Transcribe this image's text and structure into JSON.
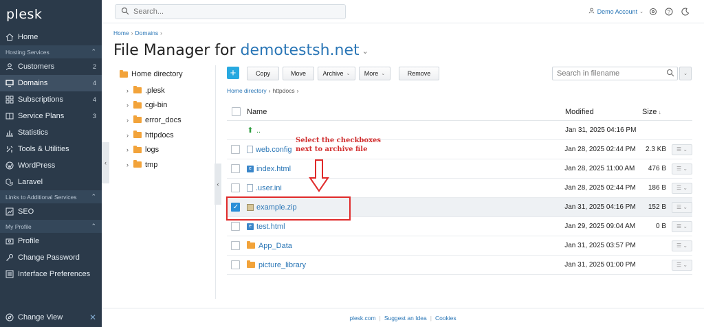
{
  "sidebar": {
    "logo": "plesk",
    "home": "Home",
    "hosting_section": "Hosting Services",
    "items": [
      {
        "label": "Customers",
        "count": "2",
        "icon": "user-icon"
      },
      {
        "label": "Domains",
        "count": "4",
        "icon": "monitor-icon"
      },
      {
        "label": "Subscriptions",
        "count": "4",
        "icon": "grid-icon"
      },
      {
        "label": "Service Plans",
        "count": "3",
        "icon": "book-icon"
      },
      {
        "label": "Statistics",
        "count": "",
        "icon": "chart-icon"
      },
      {
        "label": "Tools & Utilities",
        "count": "",
        "icon": "tools-icon"
      },
      {
        "label": "WordPress",
        "count": "",
        "icon": "wordpress-icon"
      },
      {
        "label": "Laravel",
        "count": "",
        "icon": "laravel-icon"
      }
    ],
    "links_section": "Links to Additional Services",
    "seo": "SEO",
    "profile_section": "My Profile",
    "profile": "Profile",
    "change_password": "Change Password",
    "interface_prefs": "Interface Preferences",
    "change_view": "Change View"
  },
  "header": {
    "search_placeholder": "Search...",
    "account": "Demo Account"
  },
  "breadcrumb": {
    "home": "Home",
    "domains": "Domains"
  },
  "title": {
    "prefix": "File Manager for",
    "domain": "demotestsh.net"
  },
  "tree": {
    "root": "Home directory",
    "items": [
      ".plesk",
      "cgi-bin",
      "error_docs",
      "httpdocs",
      "logs",
      "tmp"
    ]
  },
  "toolbar": {
    "copy": "Copy",
    "move": "Move",
    "archive": "Archive",
    "more": "More",
    "remove": "Remove",
    "search_placeholder": "Search in filename"
  },
  "path": {
    "root": "Home directory",
    "current": "httpdocs"
  },
  "table": {
    "col_name": "Name",
    "col_modified": "Modified",
    "col_size": "Size",
    "rows": [
      {
        "name": "..",
        "modified": "Jan 31, 2025 04:16 PM",
        "size": "",
        "type": "up"
      },
      {
        "name": "web.config",
        "modified": "Jan 28, 2025 02:44 PM",
        "size": "2.3 KB",
        "type": "file"
      },
      {
        "name": "index.html",
        "modified": "Jan 28, 2025 11:00 AM",
        "size": "476 B",
        "type": "html"
      },
      {
        "name": ".user.ini",
        "modified": "Jan 28, 2025 02:44 PM",
        "size": "186 B",
        "type": "file"
      },
      {
        "name": "example.zip",
        "modified": "Jan 31, 2025 04:16 PM",
        "size": "152 B",
        "type": "zip",
        "checked": true
      },
      {
        "name": "test.html",
        "modified": "Jan 29, 2025 09:04 AM",
        "size": "0 B",
        "type": "html"
      },
      {
        "name": "App_Data",
        "modified": "Jan 31, 2025 03:57 PM",
        "size": "",
        "type": "folder"
      },
      {
        "name": "picture_library",
        "modified": "Jan 31, 2025 01:00 PM",
        "size": "",
        "type": "folder"
      }
    ]
  },
  "annotation": {
    "line1": "Select the checkboxes",
    "line2": "next to archive file",
    "color": "#d22f2f"
  },
  "footer": {
    "site": "plesk.com",
    "idea": "Suggest an Idea",
    "cookies": "Cookies"
  }
}
